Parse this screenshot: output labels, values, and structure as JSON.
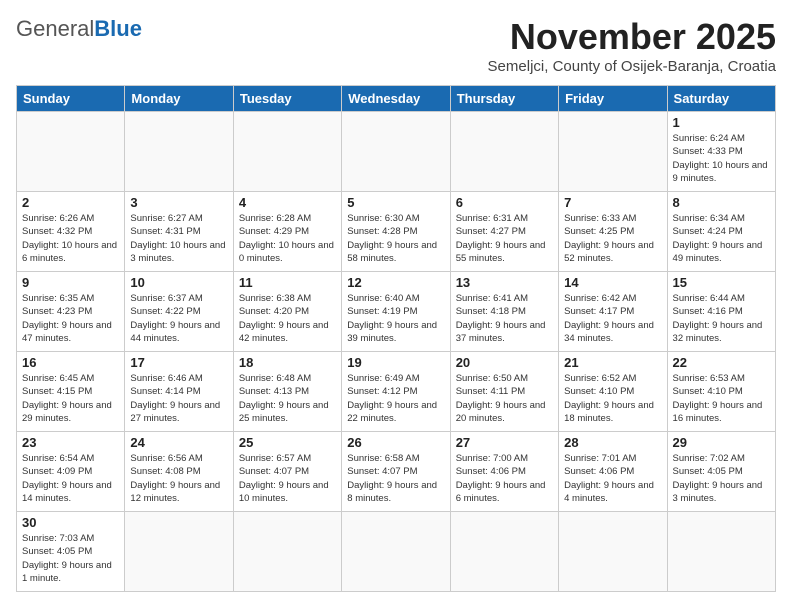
{
  "header": {
    "month_title": "November 2025",
    "location": "Semeljci, County of Osijek-Baranja, Croatia",
    "logo_general": "General",
    "logo_blue": "Blue"
  },
  "days_of_week": [
    "Sunday",
    "Monday",
    "Tuesday",
    "Wednesday",
    "Thursday",
    "Friday",
    "Saturday"
  ],
  "weeks": [
    [
      {
        "day": "",
        "info": ""
      },
      {
        "day": "",
        "info": ""
      },
      {
        "day": "",
        "info": ""
      },
      {
        "day": "",
        "info": ""
      },
      {
        "day": "",
        "info": ""
      },
      {
        "day": "",
        "info": ""
      },
      {
        "day": "1",
        "info": "Sunrise: 6:24 AM\nSunset: 4:33 PM\nDaylight: 10 hours\nand 9 minutes."
      }
    ],
    [
      {
        "day": "2",
        "info": "Sunrise: 6:26 AM\nSunset: 4:32 PM\nDaylight: 10 hours\nand 6 minutes."
      },
      {
        "day": "3",
        "info": "Sunrise: 6:27 AM\nSunset: 4:31 PM\nDaylight: 10 hours\nand 3 minutes."
      },
      {
        "day": "4",
        "info": "Sunrise: 6:28 AM\nSunset: 4:29 PM\nDaylight: 10 hours\nand 0 minutes."
      },
      {
        "day": "5",
        "info": "Sunrise: 6:30 AM\nSunset: 4:28 PM\nDaylight: 9 hours\nand 58 minutes."
      },
      {
        "day": "6",
        "info": "Sunrise: 6:31 AM\nSunset: 4:27 PM\nDaylight: 9 hours\nand 55 minutes."
      },
      {
        "day": "7",
        "info": "Sunrise: 6:33 AM\nSunset: 4:25 PM\nDaylight: 9 hours\nand 52 minutes."
      },
      {
        "day": "8",
        "info": "Sunrise: 6:34 AM\nSunset: 4:24 PM\nDaylight: 9 hours\nand 49 minutes."
      }
    ],
    [
      {
        "day": "9",
        "info": "Sunrise: 6:35 AM\nSunset: 4:23 PM\nDaylight: 9 hours\nand 47 minutes."
      },
      {
        "day": "10",
        "info": "Sunrise: 6:37 AM\nSunset: 4:22 PM\nDaylight: 9 hours\nand 44 minutes."
      },
      {
        "day": "11",
        "info": "Sunrise: 6:38 AM\nSunset: 4:20 PM\nDaylight: 9 hours\nand 42 minutes."
      },
      {
        "day": "12",
        "info": "Sunrise: 6:40 AM\nSunset: 4:19 PM\nDaylight: 9 hours\nand 39 minutes."
      },
      {
        "day": "13",
        "info": "Sunrise: 6:41 AM\nSunset: 4:18 PM\nDaylight: 9 hours\nand 37 minutes."
      },
      {
        "day": "14",
        "info": "Sunrise: 6:42 AM\nSunset: 4:17 PM\nDaylight: 9 hours\nand 34 minutes."
      },
      {
        "day": "15",
        "info": "Sunrise: 6:44 AM\nSunset: 4:16 PM\nDaylight: 9 hours\nand 32 minutes."
      }
    ],
    [
      {
        "day": "16",
        "info": "Sunrise: 6:45 AM\nSunset: 4:15 PM\nDaylight: 9 hours\nand 29 minutes."
      },
      {
        "day": "17",
        "info": "Sunrise: 6:46 AM\nSunset: 4:14 PM\nDaylight: 9 hours\nand 27 minutes."
      },
      {
        "day": "18",
        "info": "Sunrise: 6:48 AM\nSunset: 4:13 PM\nDaylight: 9 hours\nand 25 minutes."
      },
      {
        "day": "19",
        "info": "Sunrise: 6:49 AM\nSunset: 4:12 PM\nDaylight: 9 hours\nand 22 minutes."
      },
      {
        "day": "20",
        "info": "Sunrise: 6:50 AM\nSunset: 4:11 PM\nDaylight: 9 hours\nand 20 minutes."
      },
      {
        "day": "21",
        "info": "Sunrise: 6:52 AM\nSunset: 4:10 PM\nDaylight: 9 hours\nand 18 minutes."
      },
      {
        "day": "22",
        "info": "Sunrise: 6:53 AM\nSunset: 4:10 PM\nDaylight: 9 hours\nand 16 minutes."
      }
    ],
    [
      {
        "day": "23",
        "info": "Sunrise: 6:54 AM\nSunset: 4:09 PM\nDaylight: 9 hours\nand 14 minutes."
      },
      {
        "day": "24",
        "info": "Sunrise: 6:56 AM\nSunset: 4:08 PM\nDaylight: 9 hours\nand 12 minutes."
      },
      {
        "day": "25",
        "info": "Sunrise: 6:57 AM\nSunset: 4:07 PM\nDaylight: 9 hours\nand 10 minutes."
      },
      {
        "day": "26",
        "info": "Sunrise: 6:58 AM\nSunset: 4:07 PM\nDaylight: 9 hours\nand 8 minutes."
      },
      {
        "day": "27",
        "info": "Sunrise: 7:00 AM\nSunset: 4:06 PM\nDaylight: 9 hours\nand 6 minutes."
      },
      {
        "day": "28",
        "info": "Sunrise: 7:01 AM\nSunset: 4:06 PM\nDaylight: 9 hours\nand 4 minutes."
      },
      {
        "day": "29",
        "info": "Sunrise: 7:02 AM\nSunset: 4:05 PM\nDaylight: 9 hours\nand 3 minutes."
      }
    ],
    [
      {
        "day": "30",
        "info": "Sunrise: 7:03 AM\nSunset: 4:05 PM\nDaylight: 9 hours\nand 1 minute."
      },
      {
        "day": "",
        "info": ""
      },
      {
        "day": "",
        "info": ""
      },
      {
        "day": "",
        "info": ""
      },
      {
        "day": "",
        "info": ""
      },
      {
        "day": "",
        "info": ""
      },
      {
        "day": "",
        "info": ""
      }
    ]
  ]
}
